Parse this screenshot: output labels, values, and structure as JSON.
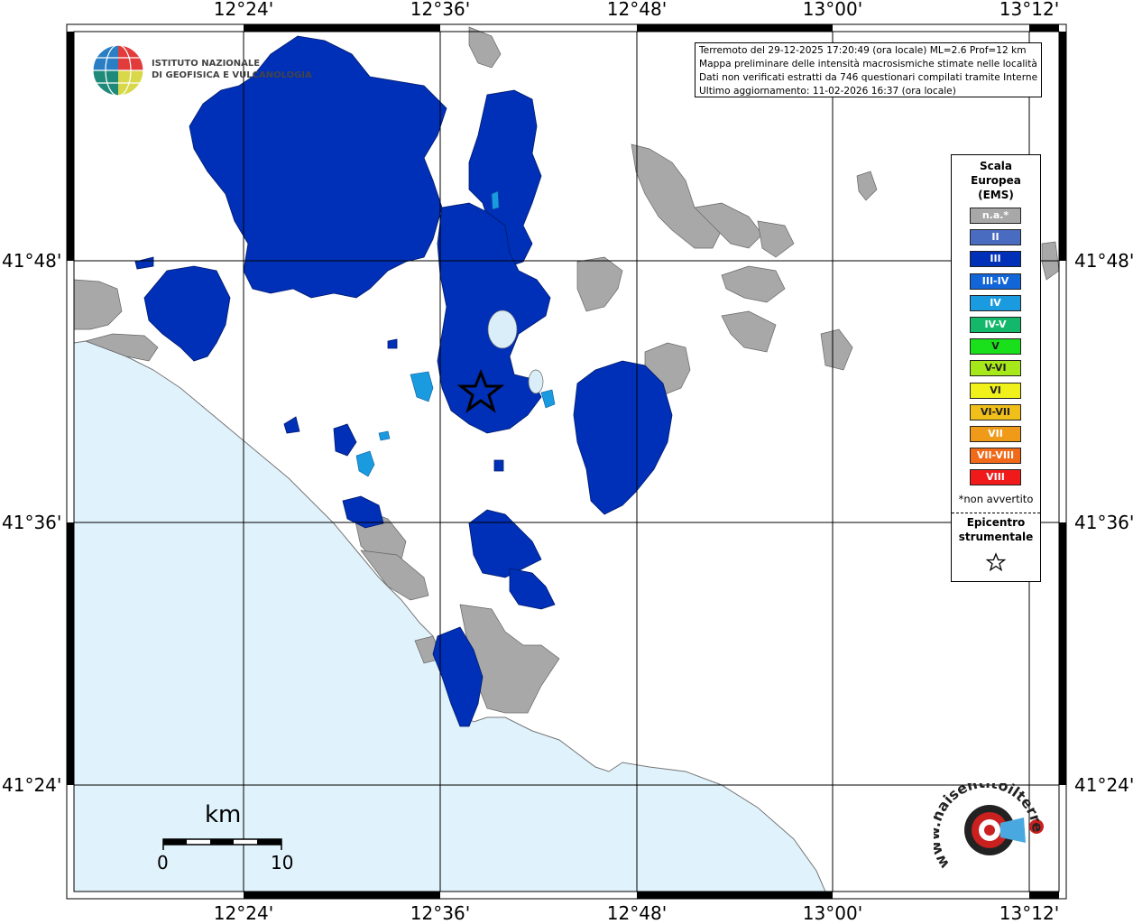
{
  "map": {
    "ticks": {
      "lon": [
        "12°24'",
        "12°36'",
        "12°48'",
        "13°00'",
        "13°12'"
      ],
      "lat": [
        "41°48'",
        "41°36'",
        "41°24'"
      ]
    },
    "info_lines": [
      "Terremoto del 29-12-2025 17:20:49 (ora locale) ML=2.6 Prof=12 km",
      "Mappa preliminare delle intensità macrosismiche stimate nelle località",
      "Dati non verificati estratti da 746 questionari compilati tramite Internet.",
      "Ultimo aggiornamento: 11-02-2026 16:37 (ora locale)"
    ],
    "colors": {
      "sea": "#e0f2fb",
      "land": "#ffffff",
      "intensity_III": "#0030b8",
      "intensity_IV": "#1a9be0",
      "not_felt": "#a8a8a8",
      "lake": "#d9eef8"
    }
  },
  "ingv": {
    "line1": "ISTITUTO NAZIONALE",
    "line2": "DI GEOFISICA E VULCANOLOGIA"
  },
  "legend": {
    "title": [
      "Scala",
      "Europea",
      "(EMS)"
    ],
    "items": [
      {
        "label": "n.a.*",
        "color": "#a8a8a8"
      },
      {
        "label": "II",
        "color": "#4a6cc0"
      },
      {
        "label": "III",
        "color": "#0030b8"
      },
      {
        "label": "III-IV",
        "color": "#1266d8"
      },
      {
        "label": "IV",
        "color": "#1a9be0"
      },
      {
        "label": "IV-V",
        "color": "#14b86a"
      },
      {
        "label": "V",
        "color": "#19e01a"
      },
      {
        "label": "V-VI",
        "color": "#a6e81a"
      },
      {
        "label": "VI",
        "color": "#f0f01a"
      },
      {
        "label": "VI-VII",
        "color": "#f0bf1a"
      },
      {
        "label": "VII",
        "color": "#f09a1a"
      },
      {
        "label": "VII-VIII",
        "color": "#f06a1a"
      },
      {
        "label": "VIII",
        "color": "#f01a1a"
      }
    ],
    "na_note": "*non avvertito",
    "epicenter": [
      "Epicentro",
      "strumentale"
    ]
  },
  "scale": {
    "title": "km",
    "min": "0",
    "max": "10"
  },
  "brand": {
    "site": "www.haisentitoilterremoto.it"
  }
}
